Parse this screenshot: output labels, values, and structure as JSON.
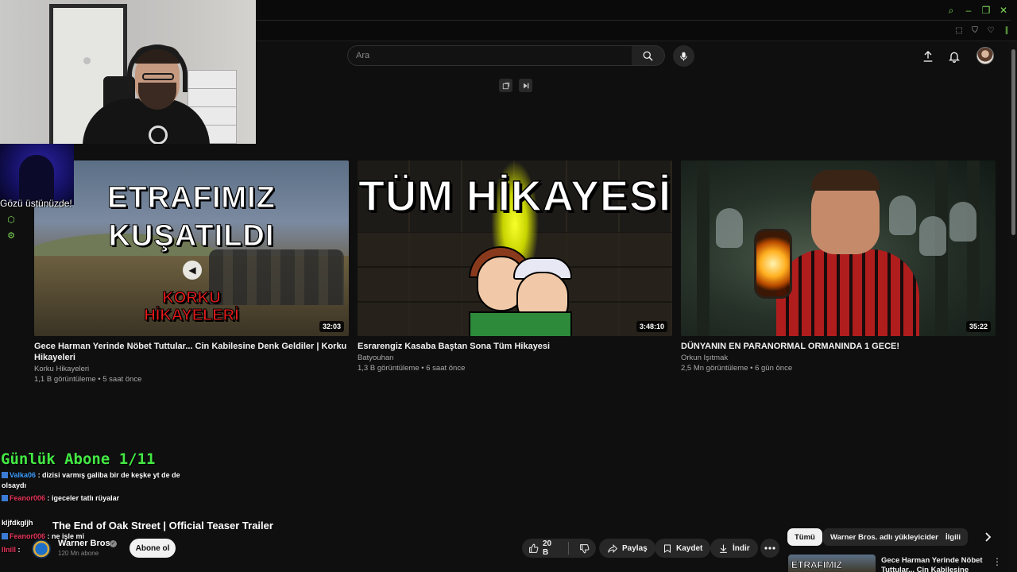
{
  "search": {
    "placeholder": "Ara"
  },
  "webcam_caption": "Gözü üstünüzde!",
  "videos": [
    {
      "thumb_line1": "ETRAFIMIZ",
      "thumb_line2": "KUŞATILDI",
      "thumb_red1": "KORKU",
      "thumb_red2": "HİKAYELERİ",
      "duration": "32:03",
      "title": "Gece Harman Yerinde Nöbet Tuttular... Cin Kabilesine Denk Geldiler | Korku Hikayeleri",
      "channel": "Korku Hikayeleri",
      "meta": "1,1 B görüntüleme • 5 saat önce"
    },
    {
      "thumb_text": "TÜM HİKAYESİ",
      "duration": "3:48:10",
      "title": "Esrarengiz Kasaba Baştan Sona Tüm Hikayesi",
      "channel": "Batyouhan",
      "meta": "1,3 B görüntüleme • 6 saat önce"
    },
    {
      "duration": "35:22",
      "title": "DÜNYANIN EN PARANORMAL ORMANINDA 1 GECE!",
      "channel": "Orkun Işıtmak",
      "meta": "2,5 Mn görüntüleme • 6 gün önce"
    }
  ],
  "chat": {
    "title": "Günlük Abone 1/11",
    "messages": [
      {
        "user": "Valka06",
        "text": ": dizisi varmış galiba bir de keşke yt de de olsaydı"
      },
      {
        "user": "Feanor006",
        "text": ": igeceler tatlı rüyalar"
      },
      {
        "user": "",
        "text": "kljfdkgljh"
      },
      {
        "user": "Feanor006",
        "text": ": ne işle mi"
      },
      {
        "user": "llnill",
        "text": ":"
      }
    ]
  },
  "watch": {
    "title": "The End of Oak Street | Official Teaser Trailer",
    "channel": "Warner Bros.",
    "subscribers": "120 Mn abone",
    "subscribe_label": "Abone ol",
    "like_count": "20 B",
    "share_label": "Paylaş",
    "save_label": "Kaydet",
    "download_label": "İndir"
  },
  "chips": [
    "Tümü",
    "Warner Bros. adlı yükleyiciden",
    "İlgili"
  ],
  "sidebar_next": {
    "thumb_text": "ETRAFIMIZ",
    "title": "Gece Harman Yerinde Nöbet Tuttular... Cin Kabilesine Denk"
  },
  "colors": {
    "background": "#0f0f0f",
    "chat_title": "#43e843",
    "accent_green": "#7ed957"
  }
}
